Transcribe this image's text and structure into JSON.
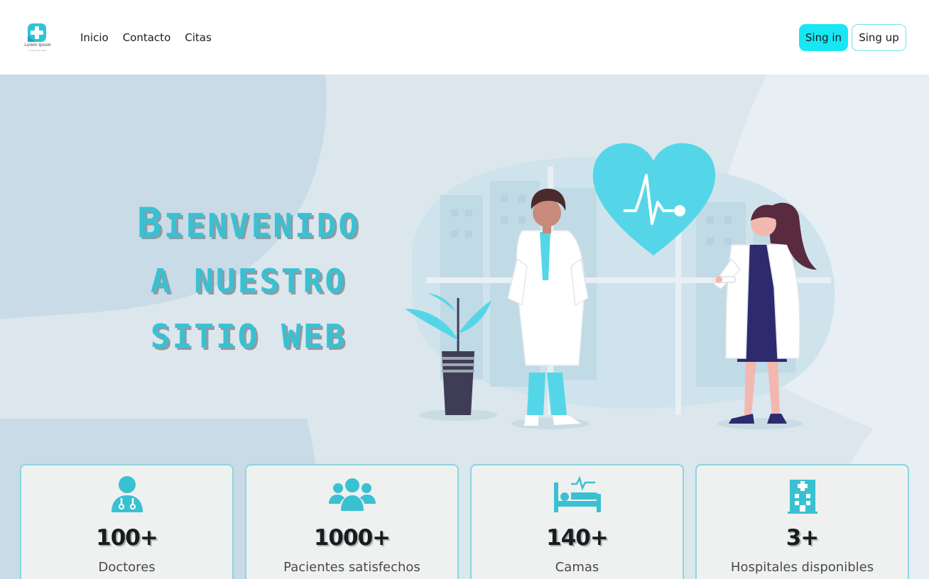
{
  "brand": {
    "logo_text": "Lorem Ipsum",
    "logo_subtext": "Lorem Ipsum dolor",
    "accent_color": "#39c1d2",
    "button_color": "#17e7f2"
  },
  "nav": {
    "items": [
      {
        "label": "Inicio"
      },
      {
        "label": "Contacto"
      },
      {
        "label": "Citas"
      }
    ]
  },
  "auth": {
    "signin_label": "Sing in",
    "signup_label": "Sing up"
  },
  "hero": {
    "title_line1_initial": "B",
    "title_line1_rest": "IENVENIDO",
    "title_line2": "A NUESTRO",
    "title_line3": "SITIO WEB",
    "illustration": "doctors-heart-illustration"
  },
  "stats": [
    {
      "value": "100+",
      "label": "Doctores",
      "icon": "doctor-icon"
    },
    {
      "value": "1000+",
      "label": "Pacientes satisfechos",
      "icon": "users-icon"
    },
    {
      "value": "140+",
      "label": "Camas",
      "icon": "bed-icon"
    },
    {
      "value": "3+",
      "label": "Hospitales disponibles",
      "icon": "hospital-icon"
    }
  ]
}
